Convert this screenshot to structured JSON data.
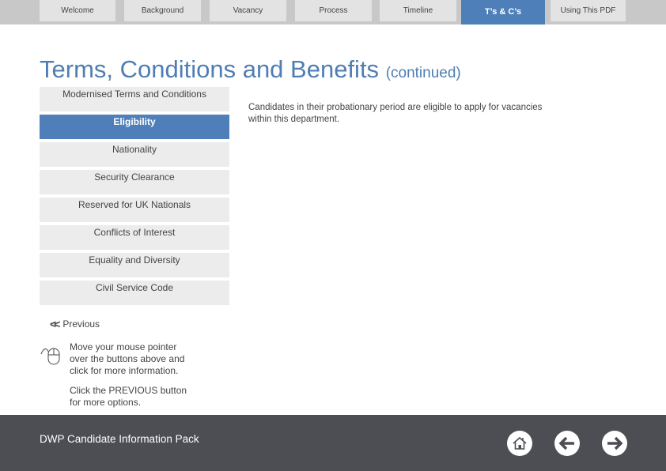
{
  "tabs": [
    {
      "label": "Welcome",
      "active": false
    },
    {
      "label": "Background",
      "active": false
    },
    {
      "label": "Vacancy",
      "active": false
    },
    {
      "label": "Process",
      "active": false
    },
    {
      "label": "Timeline",
      "active": false
    },
    {
      "label": "T’s & C’s",
      "active": true
    },
    {
      "label": "Using This PDF",
      "active": false
    }
  ],
  "page": {
    "title": "Terms, Conditions and Benefits",
    "title_suffix": "(continued)"
  },
  "menu": [
    {
      "label": "Modernised Terms and Conditions",
      "active": false
    },
    {
      "label": "Eligibility",
      "active": true
    },
    {
      "label": "Nationality",
      "active": false
    },
    {
      "label": "Security Clearance",
      "active": false
    },
    {
      "label": "Reserved for UK Nationals",
      "active": false
    },
    {
      "label": "Conflicts of Interest",
      "active": false
    },
    {
      "label": "Equality and Diversity",
      "active": false
    },
    {
      "label": "Civil Service Code",
      "active": false
    }
  ],
  "content": {
    "text": "Candidates in their probationary period are eligible to apply for vacancies within this department."
  },
  "previous": {
    "icon": "double-chevron-left-icon",
    "label": "Previous"
  },
  "help": {
    "icon": "mouse-icon",
    "line1": "Move your mouse pointer over the buttons above and click for more information.",
    "line2": "Click the PREVIOUS button for more options."
  },
  "footer": {
    "title": "DWP Candidate Information Pack",
    "buttons": [
      "home-icon",
      "arrow-left-icon",
      "arrow-right-icon"
    ]
  },
  "colors": {
    "accent": "#4e7fb9",
    "title": "#4f7eb3",
    "footer": "#4d4e53",
    "tab_bg": "#e3e3e3",
    "menu_bg": "#ececec"
  }
}
